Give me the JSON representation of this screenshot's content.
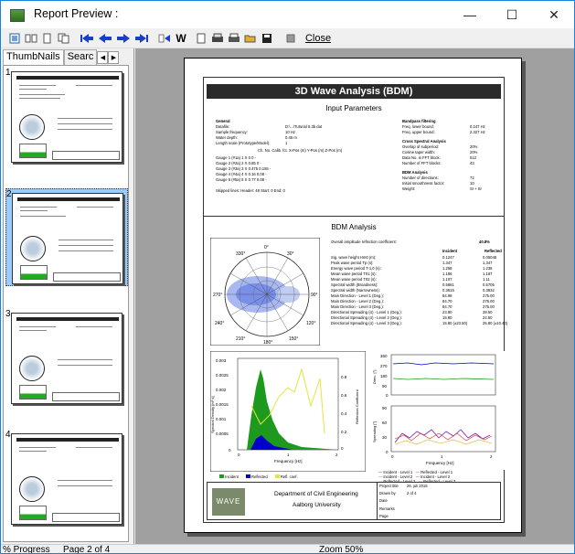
{
  "window": {
    "title": "Report Preview :",
    "minimize": "—",
    "maximize": "☐",
    "close": "✕"
  },
  "toolbar": {
    "close_label": "Close"
  },
  "tabs": [
    "ThumbNails",
    "Searc"
  ],
  "thumbnails": [
    "1",
    "2",
    "3",
    "4"
  ],
  "status": {
    "progress": "% Progress",
    "page": "Page 2 of 4",
    "zoom": "Zoom 50%"
  },
  "report": {
    "title": "3D Wave Analysis (BDM)",
    "input_title": "Input Parameters",
    "general": [
      "General",
      "Datafile:",
      "Sample frequency:",
      "Water depth:",
      "Length scale (Prototype/Model):"
    ],
    "general_vals": [
      "D:\\...\\Tutorial 5.3b.dat",
      "10 Hz",
      "0.45 m",
      "1"
    ],
    "gauge_hdr": "Ch. No.  Calib. fct.    X-Pos (m)   Y-Pos (m)   Z-Pos (m)",
    "gauges": [
      "Gauge 1 (#1a)   1   X   0   0   -",
      "Gauge 2 (#2a)   2   X   0.85   0   -",
      "Gauge 3 (#3a)   3   X   0.475   0.155   -",
      "Gauge 4 (#4a)   4   X   0.16   0.08   -",
      "Gauge 5 (#5a)   5   X   0.77   0.08   -"
    ],
    "skipped": "Skipped lines:          Header: 48     Start: 0    End: 0",
    "bandpass": [
      "Bandpass filtering",
      "Freq. lower bound:",
      "Freq. upper bound:"
    ],
    "bandpass_vals": [
      "0.247 Hz",
      "2.327 Hz"
    ],
    "cross": [
      "Cross Spectral Analysis",
      "Overlap of subperiod:",
      "Cosine taper width:",
      "Data No. in FFT block:",
      "Number of FFT blocks:"
    ],
    "cross_vals": [
      "20%",
      "20%",
      "512",
      "43"
    ],
    "bdm": [
      "BDM Analysis",
      "Number of directions:",
      "Initial smoothness factor:",
      "Weight:"
    ],
    "bdm_vals": [
      "72",
      "10",
      "SI + Sr"
    ],
    "bdm_title": "BDM Analysis",
    "coef": "Overall amplitude reflection coefficient:",
    "coef_val": "40.8%",
    "col_inc": "Incident",
    "col_ref": "Reflected",
    "rows": [
      "Sig. wave height Hm0 (m):",
      "Peak wave period Tp (s):",
      "Energy wave period T-1,0 (s):",
      "Mean wave period T01 (s):",
      "Mean wave period T02 (s):",
      "Spectral width (Broadness):",
      "Spectral width (Narrowness):",
      "Main Direction - Level 1 (Deg.):",
      "Main Direction - Level 2 (Deg.):",
      "Main Direction - Level 3 (Deg.):",
      "Directional Spreading (σ) - Level 1 (Deg.):",
      "Directional Spreading (σ) - Level 2 (Deg.):",
      "Directional Spreading (σ) - Level 3 (Deg.):"
    ],
    "inc": [
      "0.1247",
      "1.347",
      "1.258",
      "1.186",
      "1.107",
      "0.5681",
      "0.3615",
      "84.98",
      "84.70",
      "84.70",
      "23.80",
      "15.80",
      "15.80 (±23.50)"
    ],
    "ref": [
      "0.05048",
      "1.347",
      "1.236",
      "1.167",
      "1.11",
      "0.5705",
      "0.3832",
      "275.00",
      "275.00",
      "275.00",
      "28.50",
      "24.50",
      "25.80 (±10.40)"
    ],
    "polar_labels": [
      "0°",
      "30°",
      "330°",
      "270°",
      "90°",
      "240°",
      "120°",
      "210°",
      "180°",
      "150°"
    ],
    "legend": [
      "Incident",
      "Reflected",
      "Refl. coef."
    ],
    "legend2": [
      "Incident - Level 1",
      "Reflected - Level 1",
      "Incident - Level 2",
      "Incident - Level 3",
      "Reflected - Level 2",
      "Reflected - Level 3"
    ],
    "spec_ylabel": "Spectral Density [m²·s]",
    "spec_y2label": "Reflection Coefficient",
    "freq_label": "Frequency [Hz]",
    "spec_yticks": [
      "0.003",
      "0.0025",
      "0.002",
      "0.0015",
      "0.001",
      "0.0005",
      "0"
    ],
    "spec_y2ticks": [
      "0.8",
      "0.6",
      "0.4",
      "0.2",
      "0"
    ],
    "xticks": [
      "0",
      "1",
      "2"
    ],
    "dir_yticks": [
      "360",
      "270",
      "180",
      "90",
      "0"
    ],
    "spr_yticks": [
      "90",
      "60",
      "30",
      "0"
    ],
    "dir_label": "Direc. [°]",
    "spr_label": "Spreading [°]",
    "logo": "WAVE LAB",
    "dept": "Department of Civil Engineering",
    "uni": "Aalborg University",
    "meta": [
      "Project title",
      "Drawn by",
      "Date",
      "Remarks",
      "Page"
    ],
    "meta_vals": [
      "",
      "",
      "26. juli 2015",
      "",
      "2 of 4"
    ],
    "colors": {
      "incident": "#1d9a1d",
      "reflected": "#0000cc",
      "coef": "#e5e53a"
    }
  }
}
